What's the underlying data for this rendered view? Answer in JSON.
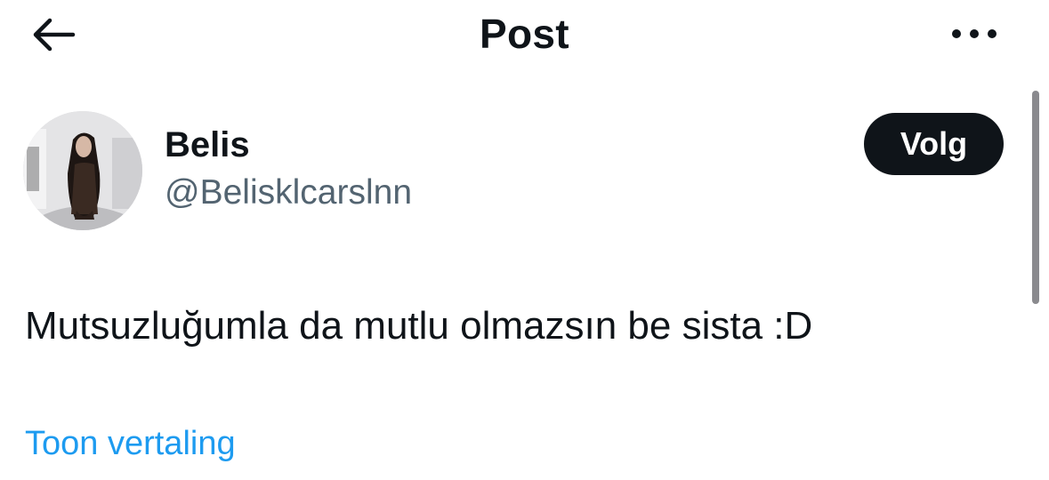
{
  "header": {
    "title": "Post",
    "back_icon": "arrow-left-icon",
    "more_icon": "more-horizontal-icon"
  },
  "author": {
    "display_name": "Belis",
    "handle": "@Belisklcarslnn",
    "follow_label": "Volg",
    "avatar_icon": "profile-photo"
  },
  "tweet": {
    "text": "Mutsuzluğumla da mutlu olmazsın be sista :D",
    "translate_label": "Toon vertaling"
  },
  "colors": {
    "text": "#0f1419",
    "secondary_text": "#536471",
    "link": "#1d9bf0",
    "button_bg": "#0f1419",
    "button_text": "#ffffff"
  }
}
